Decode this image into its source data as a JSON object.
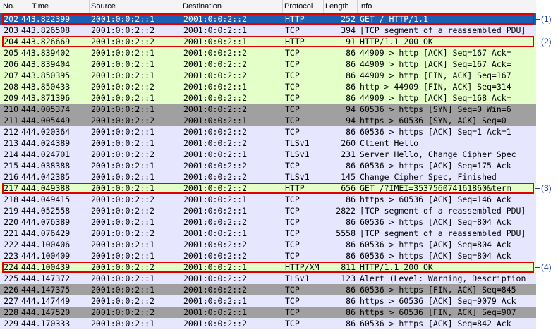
{
  "columns": {
    "no": "No.",
    "time": "Time",
    "source": "Source",
    "destination": "Destination",
    "protocol": "Protocol",
    "length": "Length",
    "info": "Info"
  },
  "colors": {
    "http": "#e4ffc7",
    "tcp": "#e7e6ff",
    "tcp_syn_fin": "#a0a0a0",
    "selected": "#1b5fb4",
    "highlight_box": "#e00000",
    "callout_text": "#1a3fa0"
  },
  "packets": [
    {
      "no": "202",
      "time": "443.822399",
      "src": "2001:0:0:2::1",
      "dst": "2001:0:0:2::2",
      "proto": "HTTP",
      "len": "252",
      "info": "GET / HTTP/1.1",
      "style": "selected"
    },
    {
      "no": "203",
      "time": "443.826508",
      "src": "2001:0:0:2::2",
      "dst": "2001:0:0:2::1",
      "proto": "TCP",
      "len": "394",
      "info": "[TCP segment of a reassembled PDU]",
      "style": "tcp"
    },
    {
      "no": "204",
      "time": "443.826669",
      "src": "2001:0:0:2::2",
      "dst": "2001:0:0:2::1",
      "proto": "HTTP",
      "len": "91",
      "info": "HTTP/1.1 200 OK",
      "style": "http"
    },
    {
      "no": "205",
      "time": "443.839402",
      "src": "2001:0:0:2::1",
      "dst": "2001:0:0:2::2",
      "proto": "TCP",
      "len": "86",
      "info": "44909 > http [ACK] Seq=167 Ack=",
      "style": "http"
    },
    {
      "no": "206",
      "time": "443.839404",
      "src": "2001:0:0:2::1",
      "dst": "2001:0:0:2::2",
      "proto": "TCP",
      "len": "86",
      "info": "44909 > http [ACK] Seq=167 Ack=",
      "style": "http"
    },
    {
      "no": "207",
      "time": "443.850395",
      "src": "2001:0:0:2::1",
      "dst": "2001:0:0:2::2",
      "proto": "TCP",
      "len": "86",
      "info": "44909 > http [FIN, ACK] Seq=167",
      "style": "http"
    },
    {
      "no": "208",
      "time": "443.850433",
      "src": "2001:0:0:2::2",
      "dst": "2001:0:0:2::1",
      "proto": "TCP",
      "len": "86",
      "info": "http > 44909 [FIN, ACK] Seq=314",
      "style": "http"
    },
    {
      "no": "209",
      "time": "443.871396",
      "src": "2001:0:0:2::1",
      "dst": "2001:0:0:2::2",
      "proto": "TCP",
      "len": "86",
      "info": "44909 > http [ACK] Seq=168 Ack=",
      "style": "http"
    },
    {
      "no": "210",
      "time": "444.005374",
      "src": "2001:0:0:2::1",
      "dst": "2001:0:0:2::2",
      "proto": "TCP",
      "len": "94",
      "info": "60536 > https [SYN] Seq=0 Win=6",
      "style": "gray"
    },
    {
      "no": "211",
      "time": "444.005449",
      "src": "2001:0:0:2::2",
      "dst": "2001:0:0:2::1",
      "proto": "TCP",
      "len": "94",
      "info": "https > 60536 [SYN, ACK] Seq=0",
      "style": "gray"
    },
    {
      "no": "212",
      "time": "444.020364",
      "src": "2001:0:0:2::1",
      "dst": "2001:0:0:2::2",
      "proto": "TCP",
      "len": "86",
      "info": "60536 > https [ACK] Seq=1 Ack=1",
      "style": "tcp"
    },
    {
      "no": "213",
      "time": "444.024389",
      "src": "2001:0:0:2::1",
      "dst": "2001:0:0:2::2",
      "proto": "TLSv1",
      "len": "260",
      "info": "Client Hello",
      "style": "tcp"
    },
    {
      "no": "214",
      "time": "444.024701",
      "src": "2001:0:0:2::2",
      "dst": "2001:0:0:2::1",
      "proto": "TLSv1",
      "len": "231",
      "info": "Server Hello, Change Cipher Spec",
      "style": "tcp"
    },
    {
      "no": "215",
      "time": "444.038388",
      "src": "2001:0:0:2::1",
      "dst": "2001:0:0:2::2",
      "proto": "TCP",
      "len": "86",
      "info": "60536 > https [ACK] Seq=175 Ack",
      "style": "tcp"
    },
    {
      "no": "216",
      "time": "444.042385",
      "src": "2001:0:0:2::1",
      "dst": "2001:0:0:2::2",
      "proto": "TLSv1",
      "len": "145",
      "info": "Change Cipher Spec, Finished",
      "style": "tcp"
    },
    {
      "no": "217",
      "time": "444.049388",
      "src": "2001:0:0:2::1",
      "dst": "2001:0:0:2::2",
      "proto": "HTTP",
      "len": "656",
      "info": "GET /?IMEI=353756074161860&term",
      "style": "http"
    },
    {
      "no": "218",
      "time": "444.049415",
      "src": "2001:0:0:2::2",
      "dst": "2001:0:0:2::1",
      "proto": "TCP",
      "len": "86",
      "info": "https > 60536 [ACK] Seq=146 Ack",
      "style": "tcp"
    },
    {
      "no": "219",
      "time": "444.052558",
      "src": "2001:0:0:2::2",
      "dst": "2001:0:0:2::1",
      "proto": "TCP",
      "len": "2822",
      "info": "[TCP segment of a reassembled PDU]",
      "style": "tcp"
    },
    {
      "no": "220",
      "time": "444.076389",
      "src": "2001:0:0:2::1",
      "dst": "2001:0:0:2::2",
      "proto": "TCP",
      "len": "86",
      "info": "60536 > https [ACK] Seq=804 Ack",
      "style": "tcp"
    },
    {
      "no": "221",
      "time": "444.076429",
      "src": "2001:0:0:2::2",
      "dst": "2001:0:0:2::1",
      "proto": "TCP",
      "len": "5558",
      "info": "[TCP segment of a reassembled PDU]",
      "style": "tcp"
    },
    {
      "no": "222",
      "time": "444.100406",
      "src": "2001:0:0:2::1",
      "dst": "2001:0:0:2::2",
      "proto": "TCP",
      "len": "86",
      "info": "60536 > https [ACK] Seq=804 Ack",
      "style": "tcp"
    },
    {
      "no": "223",
      "time": "444.100409",
      "src": "2001:0:0:2::1",
      "dst": "2001:0:0:2::2",
      "proto": "TCP",
      "len": "86",
      "info": "60536 > https [ACK] Seq=804 Ack",
      "style": "tcp"
    },
    {
      "no": "224",
      "time": "444.100439",
      "src": "2001:0:0:2::2",
      "dst": "2001:0:0:2::1",
      "proto": "HTTP/XM",
      "len": "811",
      "info": "HTTP/1.1 200 OK",
      "style": "http"
    },
    {
      "no": "225",
      "time": "444.147372",
      "src": "2001:0:0:2::1",
      "dst": "2001:0:0:2::2",
      "proto": "TLSv1",
      "len": "123",
      "info": "Alert (Level: Warning, Description",
      "style": "tcp"
    },
    {
      "no": "226",
      "time": "444.147375",
      "src": "2001:0:0:2::1",
      "dst": "2001:0:0:2::2",
      "proto": "TCP",
      "len": "86",
      "info": "60536 > https [FIN, ACK] Seq=845",
      "style": "gray"
    },
    {
      "no": "227",
      "time": "444.147449",
      "src": "2001:0:0:2::2",
      "dst": "2001:0:0:2::1",
      "proto": "TCP",
      "len": "86",
      "info": "https > 60536 [ACK] Seq=9079 Ack",
      "style": "tcp"
    },
    {
      "no": "228",
      "time": "444.147520",
      "src": "2001:0:0:2::2",
      "dst": "2001:0:0:2::1",
      "proto": "TCP",
      "len": "86",
      "info": "https > 60536 [FIN, ACK] Seq=907",
      "style": "gray"
    },
    {
      "no": "229",
      "time": "444.170333",
      "src": "2001:0:0:2::1",
      "dst": "2001:0:0:2::2",
      "proto": "TCP",
      "len": "86",
      "info": "60536 > https [ACK] Seq=842 Ack",
      "style": "tcp"
    }
  ],
  "annotations": [
    {
      "row": 0,
      "label": "(1)"
    },
    {
      "row": 2,
      "label": "(2)"
    },
    {
      "row": 15,
      "label": "(3)"
    },
    {
      "row": 22,
      "label": "(4)"
    }
  ]
}
